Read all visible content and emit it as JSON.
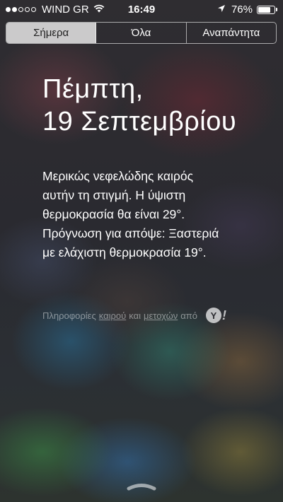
{
  "status_bar": {
    "carrier": "WIND GR",
    "time": "16:49",
    "battery_percent": "76%",
    "battery_level": 0.76,
    "signal_bars_filled": 2,
    "signal_bars_total": 5,
    "icons": [
      "wifi-icon",
      "location-arrow-icon",
      "battery-icon"
    ]
  },
  "tabs": [
    {
      "label": "Σήμερα",
      "active": true
    },
    {
      "label": "Όλα",
      "active": false
    },
    {
      "label": "Αναπάντητα",
      "active": false
    }
  ],
  "date": {
    "weekday": "Πέμπτη,",
    "day_month": "19 Σεπτεμβρίου"
  },
  "weather_summary": {
    "lines": [
      "Μερικώς νεφελώδης καιρός",
      "αυτήν τη στιγμή. Η ύψιστη",
      "θερμοκρασία θα είναι 29°.",
      "Πρόγνωση για απόψε: Ξαστεριά",
      "με ελάχιστη θερμοκρασία 19°."
    ]
  },
  "attribution": {
    "prefix": "Πληροφορίες",
    "weather_link": "καιρού",
    "and": "και",
    "stocks_link": "μετοχών",
    "suffix": "από",
    "logo": "yahoo-logo",
    "logo_letter": "Y",
    "logo_mark": "!"
  },
  "colors": {
    "active_tab_bg": "#e6e6e6",
    "text": "#ffffff"
  }
}
